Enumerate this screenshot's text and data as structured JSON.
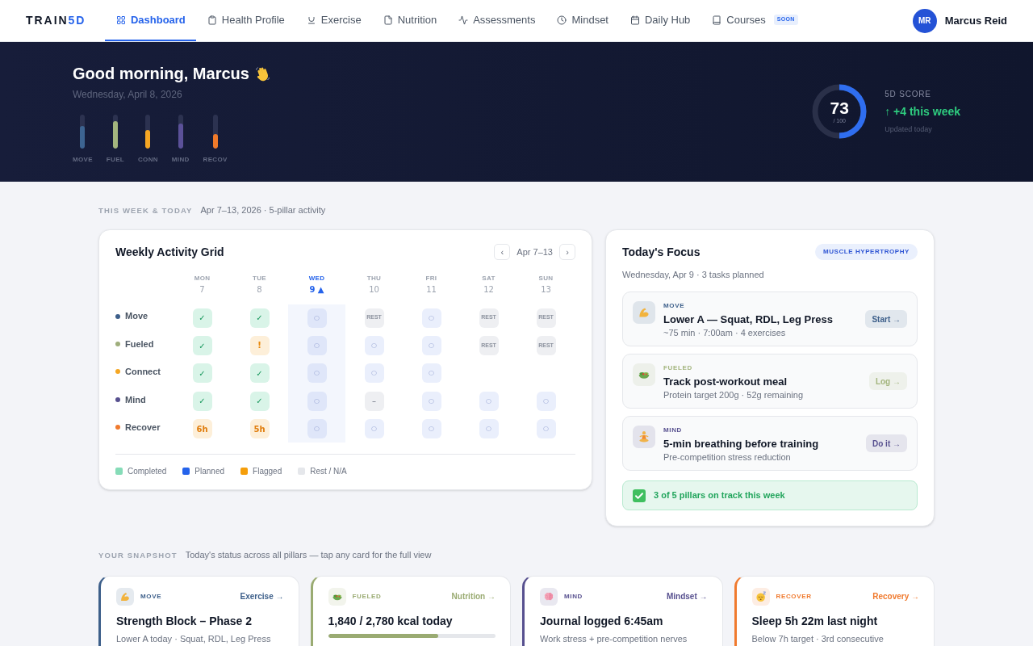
{
  "nav": {
    "logo": {
      "text": "TRAIN",
      "accent": "5D"
    },
    "tabs": [
      {
        "label": "Dashboard",
        "selected": true
      },
      {
        "label": "Health Profile",
        "selected": false
      },
      {
        "label": "Exercise",
        "selected": false
      },
      {
        "label": "Nutrition",
        "selected": false
      },
      {
        "label": "Assessments",
        "selected": false
      },
      {
        "label": "Mindset",
        "selected": false
      },
      {
        "label": "Daily Hub",
        "selected": false
      },
      {
        "label": "Courses",
        "selected": false,
        "badge": "SOON"
      }
    ],
    "user": {
      "initials": "MR",
      "name": "Marcus Reid"
    }
  },
  "hero": {
    "greeting": "Good morning, Marcus",
    "date": "Wednesday, April 8, 2026",
    "pillars": [
      {
        "label": "MOVE",
        "level": 0.66,
        "color": "#3d6491"
      },
      {
        "label": "FUEL",
        "level": 0.82,
        "color": "#a3b57e"
      },
      {
        "label": "CONN",
        "level": 0.54,
        "color": "#f5a623"
      },
      {
        "label": "MIND",
        "level": 0.74,
        "color": "#5b5199"
      },
      {
        "label": "RECOV",
        "level": 0.42,
        "color": "#f07a2a"
      }
    ],
    "score": {
      "value": "73",
      "max": "/ 100",
      "level": 0.5,
      "title": "5D SCORE",
      "change": "↑ +4 this week",
      "updated": "Updated today"
    }
  },
  "week_section": {
    "heading": "THIS WEEK & TODAY",
    "subheading": "Apr 7–13, 2026 · 5-pillar activity"
  },
  "activity_grid": {
    "title": "Weekly Activity Grid",
    "prev": "‹",
    "range": "Apr 7–13",
    "next": "›",
    "days": [
      {
        "name": "MON",
        "date": "7",
        "selected": false
      },
      {
        "name": "TUE",
        "date": "8",
        "selected": false
      },
      {
        "name": "WED",
        "date": "9 ▲",
        "selected": true
      },
      {
        "name": "THU",
        "date": "10",
        "selected": false
      },
      {
        "name": "FRI",
        "date": "11",
        "selected": false
      },
      {
        "name": "SAT",
        "date": "12",
        "selected": false
      },
      {
        "name": "SUN",
        "date": "13",
        "selected": false
      }
    ],
    "rows": [
      {
        "label": "Move",
        "color": "#3d5f8a",
        "cells": [
          {
            "kind": "done",
            "text": "✓"
          },
          {
            "kind": "done",
            "text": "✓"
          },
          {
            "kind": "planned",
            "text": "○"
          },
          {
            "kind": "rest",
            "text": "REST"
          },
          {
            "kind": "planned",
            "text": "○"
          },
          {
            "kind": "rest",
            "text": "REST"
          },
          {
            "kind": "rest",
            "text": "REST"
          }
        ]
      },
      {
        "label": "Fueled",
        "color": "#9fae7c",
        "cells": [
          {
            "kind": "done",
            "text": "✓"
          },
          {
            "kind": "flag",
            "text": "!"
          },
          {
            "kind": "planned",
            "text": "○"
          },
          {
            "kind": "planned",
            "text": "○"
          },
          {
            "kind": "planned",
            "text": "○"
          },
          {
            "kind": "rest",
            "text": "REST"
          },
          {
            "kind": "rest",
            "text": "REST"
          }
        ]
      },
      {
        "label": "Connect",
        "color": "#f5a623",
        "cells": [
          {
            "kind": "done",
            "text": "✓"
          },
          {
            "kind": "done",
            "text": "✓"
          },
          {
            "kind": "planned",
            "text": "○"
          },
          {
            "kind": "planned",
            "text": "○"
          },
          {
            "kind": "planned",
            "text": "○"
          },
          {
            "kind": "empty"
          },
          {
            "kind": "empty"
          }
        ]
      },
      {
        "label": "Mind",
        "color": "#57508f",
        "cells": [
          {
            "kind": "done",
            "text": "✓"
          },
          {
            "kind": "done",
            "text": "✓"
          },
          {
            "kind": "planned",
            "text": "○"
          },
          {
            "kind": "dash",
            "text": "–"
          },
          {
            "kind": "planned",
            "text": "○"
          },
          {
            "kind": "planned",
            "text": "○"
          },
          {
            "kind": "planned",
            "text": "○"
          }
        ]
      },
      {
        "label": "Recover",
        "color": "#f07a2e",
        "cells": [
          {
            "kind": "hours",
            "text": "6h"
          },
          {
            "kind": "hours",
            "text": "5h"
          },
          {
            "kind": "planned",
            "text": "○"
          },
          {
            "kind": "planned",
            "text": "○"
          },
          {
            "kind": "planned",
            "text": "○"
          },
          {
            "kind": "planned",
            "text": "○"
          },
          {
            "kind": "planned",
            "text": "○"
          }
        ]
      }
    ],
    "legend": [
      {
        "label": "Completed",
        "color": "#86dcb8"
      },
      {
        "label": "Planned",
        "color": "#2563eb"
      },
      {
        "label": "Flagged",
        "color": "#f59e0b"
      },
      {
        "label": "Rest / N/A",
        "color": "#e5e7eb"
      }
    ]
  },
  "focus": {
    "title": "Today's Focus",
    "badge": "MUSCLE HYPERTROPHY",
    "subtitle": "Wednesday, Apr 9 · 3 tasks planned",
    "tasks": [
      {
        "pillar": "MOVE",
        "color": "#3d5f8a",
        "title": "Lower A — Squat, RDL, Leg Press",
        "detail": "~75 min · 7:00am · 4 exercises",
        "action": "Start →"
      },
      {
        "pillar": "FUELED",
        "color": "#a3b57e",
        "title": "Track post-workout meal",
        "detail": "Protein target 200g · 52g remaining",
        "action": "Log →"
      },
      {
        "pillar": "MIND",
        "color": "#57508f",
        "title": "5-min breathing before training",
        "detail": "Pre-competition stress reduction",
        "action": "Do it →"
      }
    ],
    "summary": "3 of 5 pillars on track this week"
  },
  "snapshot": {
    "heading": "YOUR SNAPSHOT",
    "subheading": "Today's status across all pillars — tap any card for the full view",
    "cards": [
      {
        "kind": "text",
        "pillar": "MOVE",
        "color": "#3d5f8a",
        "link": "Exercise →",
        "title": "Strength Block – Phase 2",
        "detail": "Lower A today · Squat, RDL, Leg Press"
      },
      {
        "kind": "progress",
        "pillar": "FUELED",
        "color": "#9aab72",
        "link": "Nutrition →",
        "title": "1,840 / 2,780 kcal today",
        "level": 0.66
      },
      {
        "kind": "text",
        "pillar": "MIND",
        "color": "#57508f",
        "link": "Mindset →",
        "title": "Journal logged 6:45am",
        "detail": "Work stress + pre-competition nerves"
      },
      {
        "kind": "text",
        "pillar": "RECOVER",
        "color": "#f07a2e",
        "link": "Recovery →",
        "title": "Sleep 5h 22m last night",
        "detail": "Below 7h target · 3rd consecutive"
      }
    ]
  }
}
